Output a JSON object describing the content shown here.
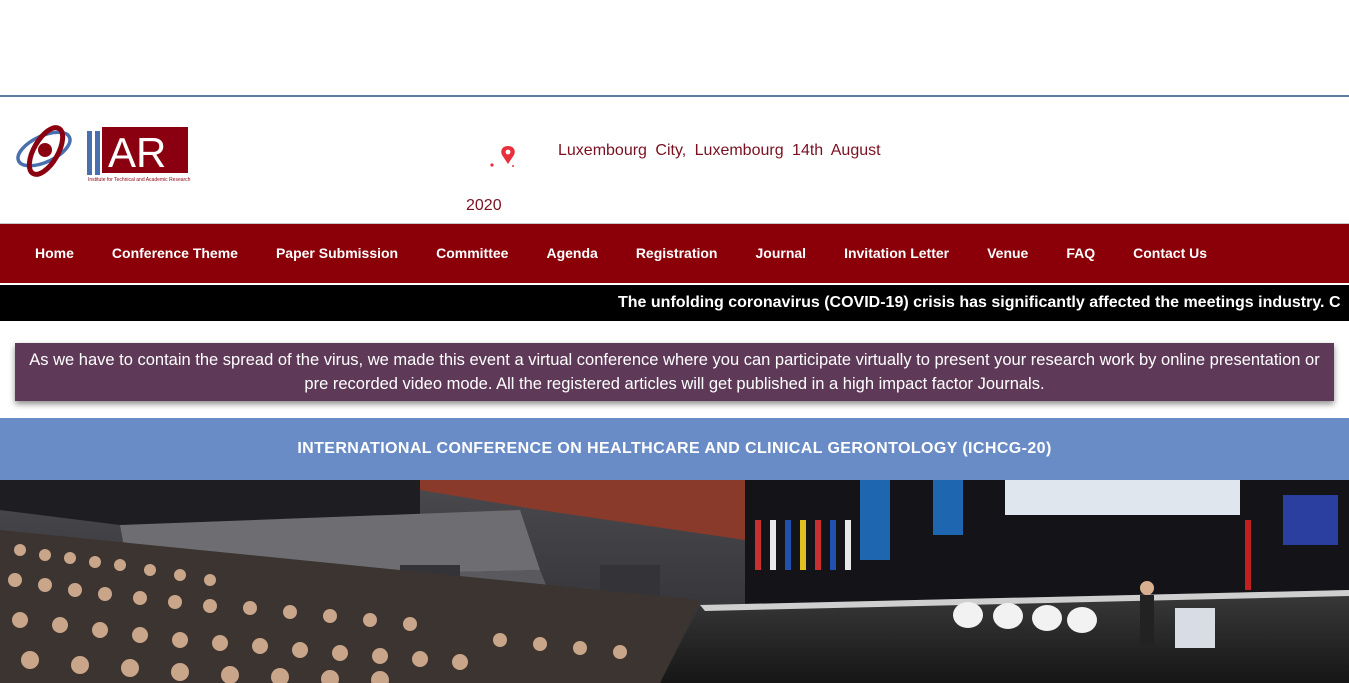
{
  "header": {
    "logo_text": "ITAR",
    "logo_subtitle": "Institute for Technical and Academic Research",
    "location": "Luxembourg City, Luxembourg 14th August",
    "year": "2020",
    "location_icon": "map-pin-icon"
  },
  "nav": {
    "items": [
      {
        "label": "Home"
      },
      {
        "label": "Conference Theme"
      },
      {
        "label": "Paper Submission"
      },
      {
        "label": "Committee"
      },
      {
        "label": "Agenda"
      },
      {
        "label": "Registration"
      },
      {
        "label": "Journal"
      },
      {
        "label": "Invitation Letter"
      },
      {
        "label": "Venue"
      },
      {
        "label": "FAQ"
      },
      {
        "label": "Contact Us"
      }
    ]
  },
  "ticker": {
    "text": "The unfolding coronavirus (COVID-19) crisis has significantly affected the meetings industry. C"
  },
  "notice": {
    "text": "As we have to contain the spread of the virus, we made this event a virtual conference where you can participate virtually to present your research work by online presentation or pre recorded video mode. All the registered articles will get published in a high impact factor Journals."
  },
  "banner": {
    "title": "INTERNATIONAL CONFERENCE ON HEALTHCARE AND CLINICAL GERONTOLOGY (ICHCG-20)"
  },
  "colors": {
    "nav_bg": "#8b0008",
    "notice_bg": "#5e3a58",
    "banner_bg": "#6a8cc6",
    "ticker_bg": "#000000",
    "location_text": "#7a1020"
  }
}
